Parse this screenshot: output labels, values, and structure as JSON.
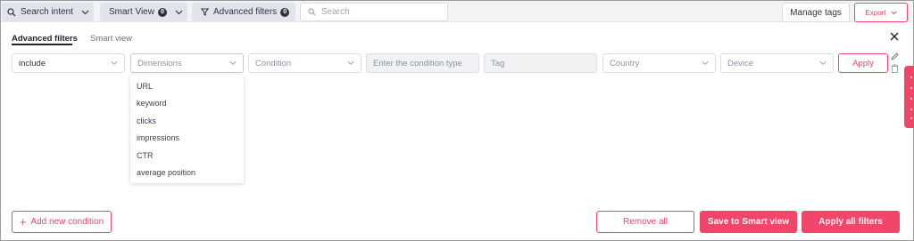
{
  "toolbar": {
    "search_intent_label": "Search intent",
    "smart_view_label": "Smart View",
    "smart_view_count": "0",
    "advanced_filters_label": "Advanced filters",
    "advanced_filters_count": "0",
    "search_placeholder": "Search",
    "manage_tags_label": "Manage tags",
    "export_label": "Export"
  },
  "tabs": [
    {
      "label": "Advanced filters",
      "active": true
    },
    {
      "label": "Smart view",
      "active": false
    }
  ],
  "filter_row": {
    "include_value": "include",
    "dimensions_placeholder": "Dimensions",
    "condition_placeholder": "Condition",
    "condition_type_placeholder": "Enter the condition type",
    "tag_placeholder": "Tag",
    "country_placeholder": "Country",
    "device_placeholder": "Device",
    "apply_label": "Apply"
  },
  "dimensions_options": [
    "URL",
    "keyword",
    "clicks",
    "impressions",
    "CTR",
    "average position"
  ],
  "footer": {
    "add_condition_label": "Add new condition",
    "remove_all_label": "Remove all",
    "save_smart_view_label": "Save to Smart view",
    "apply_all_label": "Apply all filters"
  },
  "icons": {
    "search": "search-icon",
    "chevron": "chevron-down-icon",
    "funnel": "funnel-icon",
    "close": "close-icon",
    "edit": "pencil-icon",
    "delete": "trash-icon",
    "add": "plus-icon"
  },
  "colors": {
    "accent": "#f0466a",
    "toolbar_bg": "#f2f3f5",
    "toolbar_button_bg": "#e1e4ea",
    "text": "#2f3340"
  }
}
